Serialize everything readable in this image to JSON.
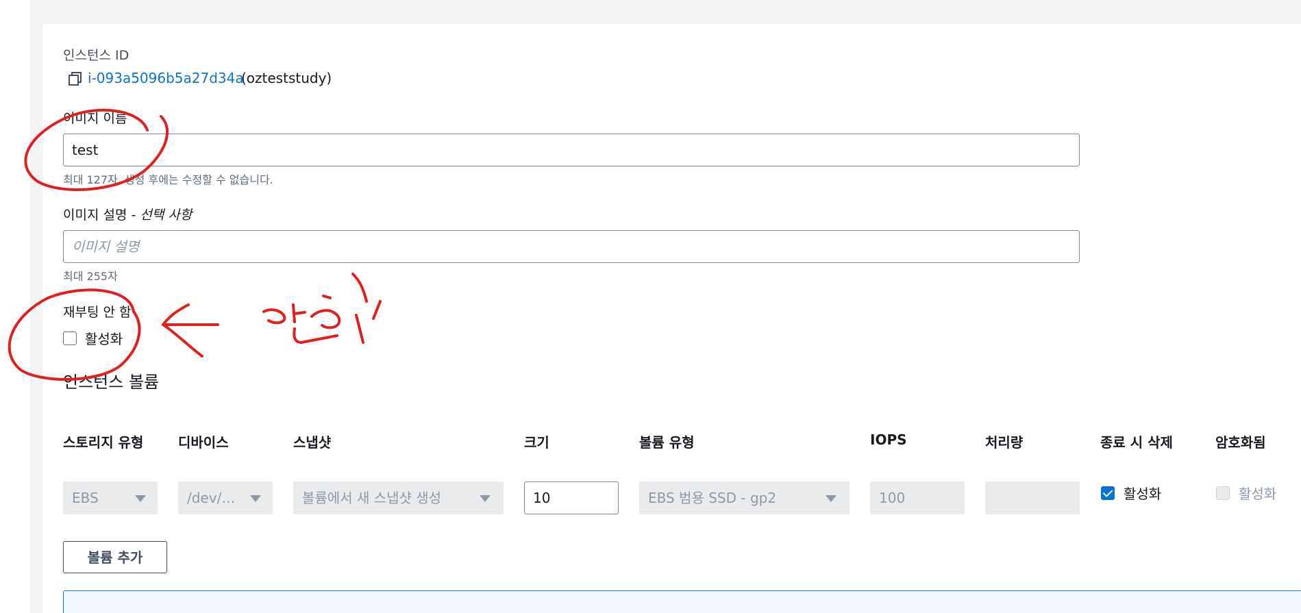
{
  "instance": {
    "label": "인스턴스 ID",
    "id_link": "i-093a5096b5a27d34a",
    "id_suffix": "(ozteststudy)"
  },
  "image_name": {
    "label": "이미지 이름",
    "value": "test",
    "hint": "최대 127자. 생성 후에는 수정할 수 없습니다."
  },
  "image_description": {
    "label": "이미지 설명 - ",
    "label_optional": "선택 사항",
    "placeholder": "이미지 설명",
    "hint": "최대 255자"
  },
  "no_reboot": {
    "label": "재부팅 안 함",
    "checkbox_label": "활성화",
    "checked": false
  },
  "volumes": {
    "title": "인스턴스 볼륨",
    "columns": [
      "스토리지 유형",
      "디바이스",
      "스냅샷",
      "크기",
      "볼륨 유형",
      "IOPS",
      "처리량",
      "종료 시 삭제",
      "암호화됨"
    ],
    "row": {
      "storage_type": "EBS",
      "device": "/dev/…",
      "snapshot": "볼륨에서 새 스냅샷 생성",
      "size": "10",
      "volume_type": "EBS 범용 SSD - gp2",
      "iops": "100",
      "throughput": "",
      "delete_on_termination": "활성화",
      "delete_on_termination_checked": true,
      "encrypted": "활성화",
      "encrypted_checked": false
    },
    "add_button": "볼륨 추가"
  },
  "annotation": {
    "handwritten_text": "안함",
    "color": "#e02020"
  },
  "colors": {
    "link": "#0972d3",
    "disabled_bg": "#e9ebed",
    "annotation": "#e02020"
  }
}
